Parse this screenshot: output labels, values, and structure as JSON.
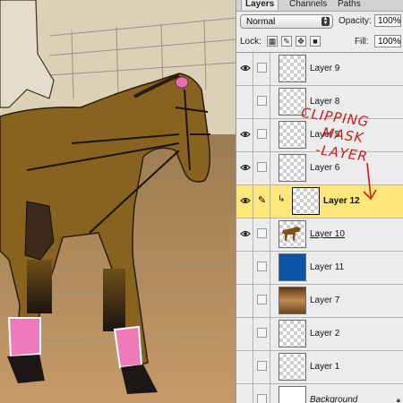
{
  "canvas": {
    "description_icon": "horse-drawing-canvas"
  },
  "panel": {
    "tabs": [
      "Layers",
      "Channels",
      "Paths"
    ],
    "blend_mode": "Normal",
    "opacity_label": "Opacity:",
    "opacity_value": "100%",
    "lock_label": "Lock:",
    "fill_label": "Fill:",
    "fill_value": "100%"
  },
  "layers": [
    {
      "name": "Layer 9",
      "visible": true,
      "thumb": "transparent"
    },
    {
      "name": "Layer 8",
      "visible": false,
      "thumb": "transparent"
    },
    {
      "name": "Layer 5",
      "visible": true,
      "thumb": "transparent"
    },
    {
      "name": "Layer 6",
      "visible": true,
      "thumb": "transparent"
    },
    {
      "name": "Layer 12",
      "visible": true,
      "thumb": "transparent",
      "selected": true,
      "clipped": true
    },
    {
      "name": "Layer 10",
      "visible": true,
      "thumb": "horse"
    },
    {
      "name": "Layer 11",
      "visible": false,
      "thumb": "blue"
    },
    {
      "name": "Layer 7",
      "visible": false,
      "thumb": "brown-gradient"
    },
    {
      "name": "Layer 2",
      "visible": false,
      "thumb": "transparent"
    },
    {
      "name": "Layer 1",
      "visible": false,
      "thumb": "transparent"
    },
    {
      "name": "Background",
      "visible": false,
      "thumb": "white",
      "locked": true
    }
  ],
  "annotation": {
    "lines": [
      "CLIPPING",
      "MASK",
      "-LAYER"
    ],
    "color": "#d11a1a"
  },
  "colors": {
    "selected_row": "#fde77a",
    "blue_fill": "#0a55a8"
  }
}
